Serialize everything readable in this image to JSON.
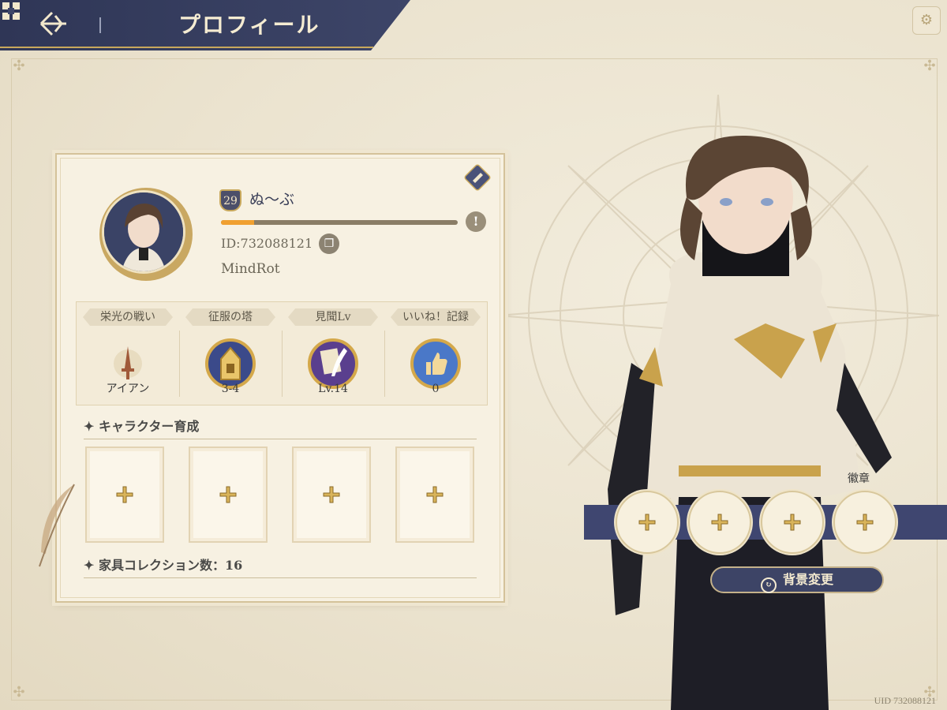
{
  "header": {
    "title": "プロフィール"
  },
  "profile": {
    "level": "29",
    "name": "ぬ～ぶ",
    "exp_progress": 0.14,
    "id_text": "ID:732088121",
    "guild": "MindRot"
  },
  "stats": [
    {
      "label": "栄光の戦い",
      "value": "アイアン",
      "icon": "sword-emblem-icon"
    },
    {
      "label": "征服の塔",
      "value": "3-4",
      "icon": "tower-emblem-icon"
    },
    {
      "label": "見聞Lv",
      "value": "Lv.14",
      "icon": "quill-emblem-icon"
    },
    {
      "label": "いいね！記録",
      "value": "0",
      "icon": "thumbs-up-emblem-icon"
    }
  ],
  "sections": {
    "character_training": "キャラクター育成",
    "furniture": "家具コレクション数：16",
    "emblem": "徽章"
  },
  "buttons": {
    "background_change": "背景変更"
  },
  "footer": {
    "uid": "UID 732088121"
  },
  "colors": {
    "navy": "#3f4670",
    "gold": "#c8a85c",
    "parchment": "#f7f1e2",
    "exp_orange": "#f0a030"
  }
}
